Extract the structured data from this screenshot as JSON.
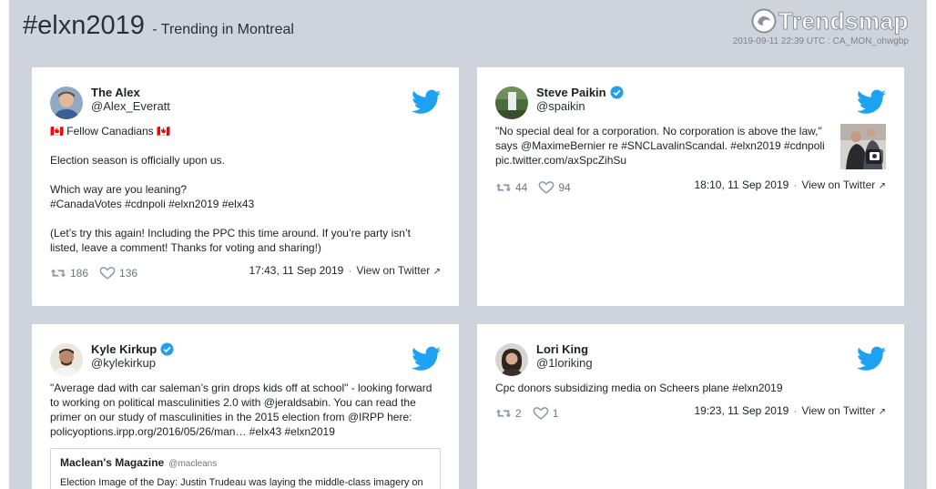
{
  "header": {
    "hashtag": "#elxn2019",
    "subtitle": "- Trending in Montreal",
    "brand": "Trendsmap",
    "meta": "2019-09-11 22:39 UTC : CA_MON_ohwgbp"
  },
  "tweets": [
    {
      "name": "The Alex",
      "handle": "@Alex_Everatt",
      "verified": false,
      "lines": [
        "🇨🇦 Fellow Canadians 🇨🇦",
        "Election season is officially upon us.",
        "Which way are you leaning?\n#CanadaVotes #cdnpoli  #elxn2019 #elx43",
        "(Let’s try this again! Including the PPC this time around. If you’re party isn’t listed, leave a comment! Thanks for voting and sharing!)"
      ],
      "retweets": "186",
      "likes": "136",
      "time": "17:43, 11 Sep 2019",
      "view": "View on Twitter"
    },
    {
      "name": "Steve Paikin",
      "handle": "@spaikin",
      "verified": true,
      "lines": [
        "\"No special deal for a corporation. No corporation is above the law,\" says @MaximeBernier re #SNCLavalinScandal. #elxn2019 #cdnpoli pic.twitter.com/axSpcZihSu"
      ],
      "retweets": "44",
      "likes": "94",
      "time": "18:10, 11 Sep 2019",
      "view": "View on Twitter"
    },
    {
      "name": "Kyle Kirkup",
      "handle": "@kylekirkup",
      "verified": true,
      "lines": [
        "\"Average dad with car saleman’s grin drops kids off at school\" - looking forward to working on political masculinities 2.0 with @jeraldsabin. You can read the primer on our study of masculinities in the 2015 election from @IRPP here: policyoptions.irpp.org/2016/05/26/man… #elx43 #elxn2019"
      ],
      "quote": {
        "name": "Maclean's Magazine",
        "handle": "@macleans",
        "text": "Election Image of the Day: Justin Trudeau was laying the middle-class imagery on"
      }
    },
    {
      "name": "Lori King",
      "handle": "@1loriking",
      "verified": false,
      "lines": [
        "Cpc donors subsidizing media on Scheers plane #elxn2019"
      ],
      "retweets": "2",
      "likes": "1",
      "time": "19:23, 11 Sep 2019",
      "view": "View on Twitter"
    }
  ],
  "colors": {
    "background": "#cfd3dc",
    "twitter_blue": "#1da1f2",
    "verified_blue": "#1da1f2"
  }
}
